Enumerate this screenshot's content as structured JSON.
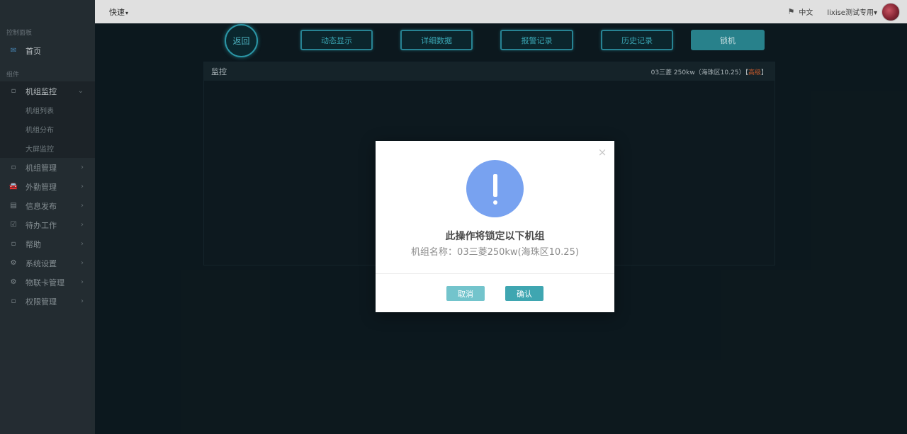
{
  "sidebar": {
    "caption_control": "控制面板",
    "caption_components": "组件",
    "home": {
      "label": "首页",
      "icon": "envelope-icon"
    },
    "items": [
      {
        "label": "机组监控",
        "icon": "square-icon",
        "expanded": true,
        "children": [
          "机组列表",
          "机组分布",
          "大屏监控"
        ]
      },
      {
        "label": "机组管理",
        "icon": "square-icon"
      },
      {
        "label": "外勤管理",
        "icon": "car-icon"
      },
      {
        "label": "信息发布",
        "icon": "document-icon"
      },
      {
        "label": "待办工作",
        "icon": "checkbox-icon"
      },
      {
        "label": "帮助",
        "icon": "square-icon"
      },
      {
        "label": "系统设置",
        "icon": "gear-icon"
      },
      {
        "label": "物联卡管理",
        "icon": "gear-icon"
      },
      {
        "label": "权限管理",
        "icon": "square-icon"
      }
    ]
  },
  "header": {
    "quick": "快速",
    "language": "中文",
    "user": "lixise测试专用"
  },
  "toolbar": {
    "back": "返回",
    "dynamic": "动态显示",
    "detail": "详细数据",
    "alarm": "报警记录",
    "history": "历史记录",
    "lock": "锁机"
  },
  "panel": {
    "title": "监控",
    "unit_info": "03三菱 250kw（海珠区10.25）",
    "level_open": "【",
    "level": "高级",
    "level_close": "】"
  },
  "modal": {
    "title": "此操作将锁定以下机组",
    "text": "机组名称：03三菱250kw(海珠区10.25)",
    "cancel": "取消",
    "confirm": "确认",
    "close": "×"
  },
  "colors": {
    "accent": "#2c8d97",
    "warning_circle": "#78a2f0",
    "level": "#d8622e"
  }
}
